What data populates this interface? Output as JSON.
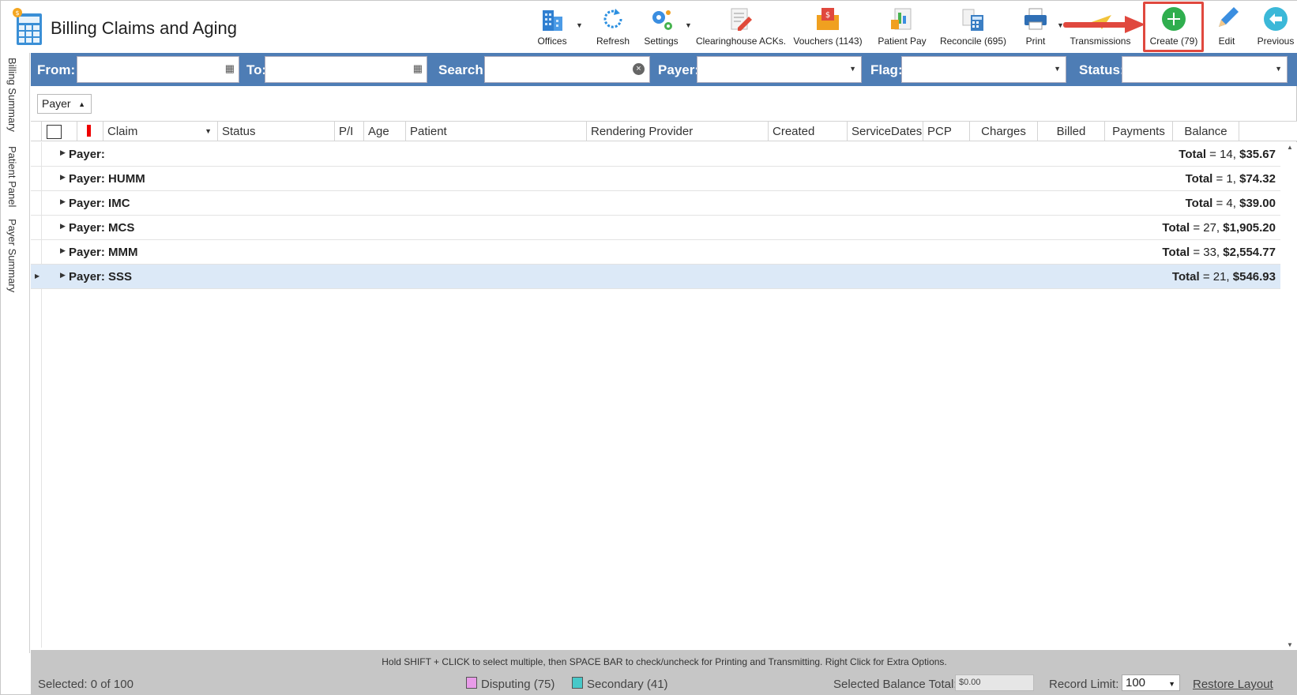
{
  "app": {
    "title": "Billing Claims and Aging"
  },
  "toolbar": {
    "offices": "Offices",
    "refresh": "Refresh",
    "settings": "Settings",
    "clearinghouse": "Clearinghouse ACKs.",
    "vouchers": "Vouchers (1143)",
    "patient_pay": "Patient Pay",
    "reconcile": "Reconcile (695)",
    "print": "Print",
    "transmissions": "Transmissions",
    "create": "Create (79)",
    "edit": "Edit",
    "previous": "Previous"
  },
  "filters": {
    "from": "From:",
    "to": "To:",
    "search": "Search:",
    "payer": "Payer:",
    "flag": "Flag:",
    "status": "Status:"
  },
  "side_tabs": [
    "Billing Summary",
    "Patient Panel",
    "Payer Summary"
  ],
  "grouping": {
    "chip": "Payer"
  },
  "columns": [
    "Claim",
    "Status",
    "P/I",
    "Age",
    "Patient",
    "Rendering Provider",
    "Created",
    "ServiceDates",
    "PCP",
    "Charges",
    "Billed",
    "Payments",
    "Balance"
  ],
  "groups": [
    {
      "label": "Payer:",
      "total_prefix": "Total",
      "total": "= 14,",
      "amount": "$35.67"
    },
    {
      "label": "Payer: HUMM",
      "total_prefix": "Total",
      "total": "= 1,",
      "amount": "$74.32"
    },
    {
      "label": "Payer: IMC",
      "total_prefix": "Total",
      "total": "= 4,",
      "amount": "$39.00"
    },
    {
      "label": "Payer: MCS",
      "total_prefix": "Total",
      "total": "= 27,",
      "amount": "$1,905.20"
    },
    {
      "label": "Payer: MMM",
      "total_prefix": "Total",
      "total": "= 33,",
      "amount": "$2,554.77"
    },
    {
      "label": "Payer: SSS",
      "total_prefix": "Total",
      "total": "= 21,",
      "amount": "$546.93"
    }
  ],
  "footer": {
    "hint": "Hold SHIFT + CLICK to select multiple, then SPACE BAR to check/uncheck for Printing and Transmitting. Right Click for Extra Options.",
    "selected": "Selected: 0 of 100",
    "disputing": "Disputing (75)",
    "secondary": "Secondary (41)",
    "selected_balance_label": "Selected Balance Total:",
    "selected_balance_value": "$0.00",
    "record_limit_label": "Record Limit:",
    "record_limit_value": "100",
    "restore_layout": "Restore Layout"
  },
  "colors": {
    "filter_bar": "#4e7db5",
    "highlight": "#e0483e",
    "create_green": "#2fae4e",
    "disputing": "#e89be8",
    "secondary": "#47c8c8"
  }
}
